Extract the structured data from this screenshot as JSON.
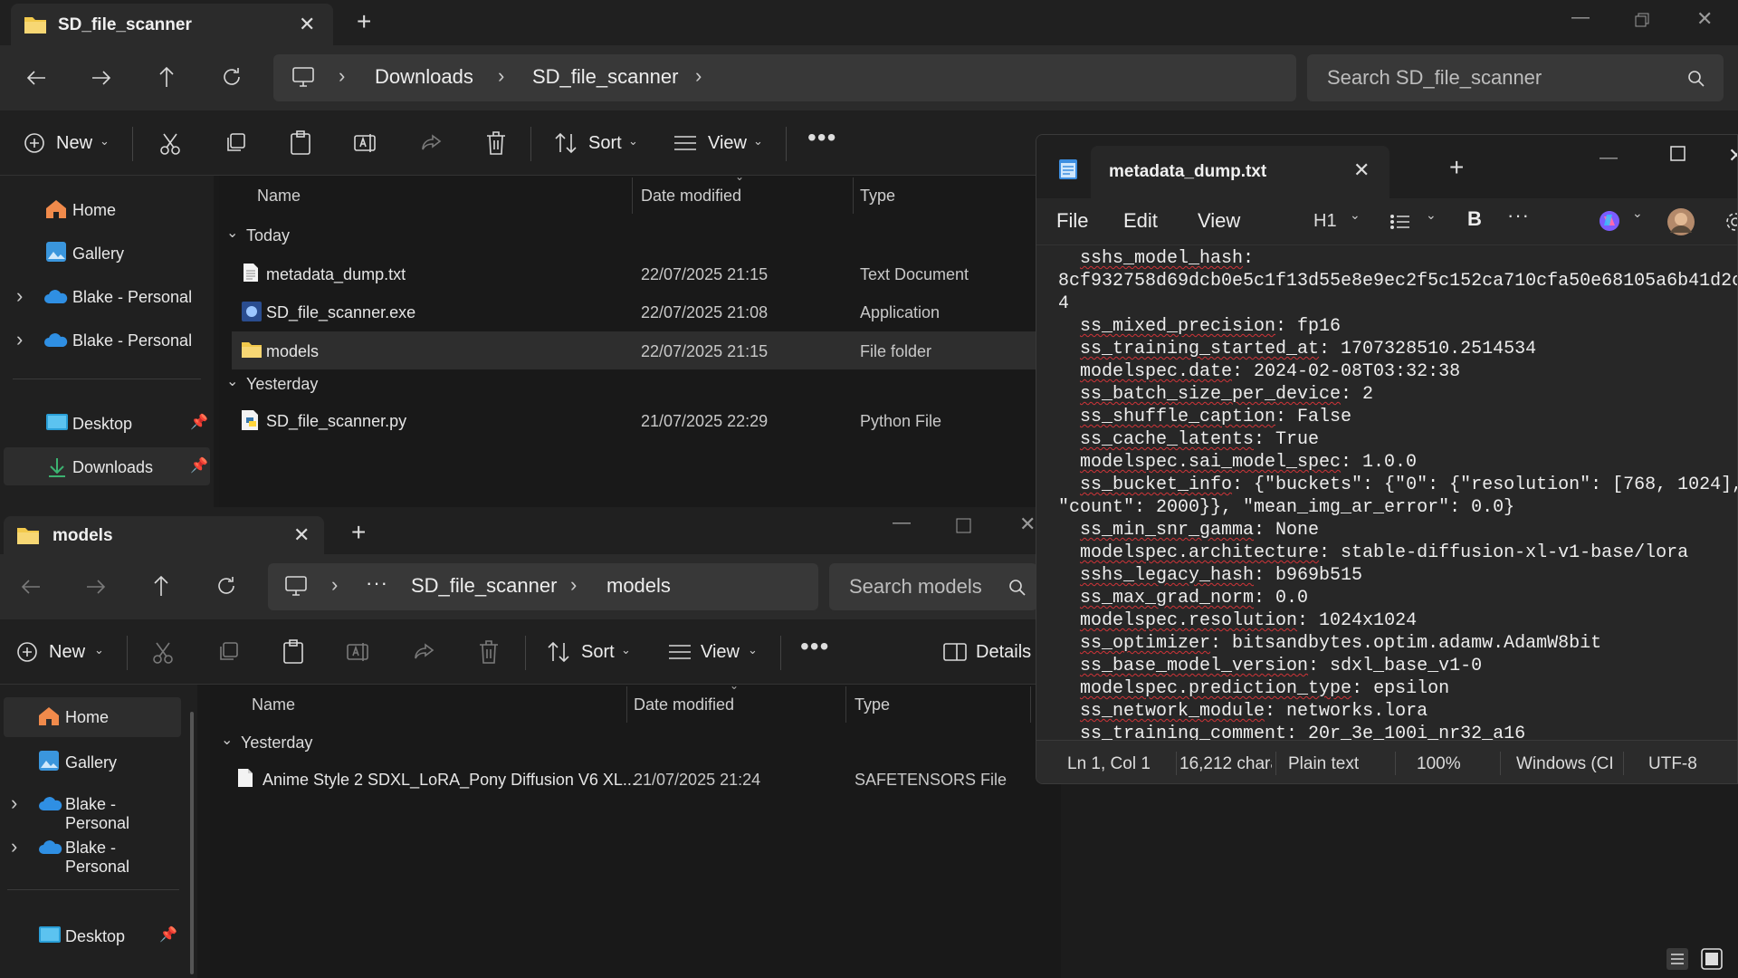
{
  "explorer_top": {
    "tab_title": "SD_file_scanner",
    "breadcrumb": [
      "Downloads",
      "SD_file_scanner"
    ],
    "search_placeholder": "Search SD_file_scanner",
    "commands": {
      "new": "New",
      "sort": "Sort",
      "view": "View"
    },
    "columns": {
      "name": "Name",
      "date": "Date modified",
      "type": "Type"
    },
    "sidebar": [
      {
        "label": "Home",
        "icon": "home-icon"
      },
      {
        "label": "Gallery",
        "icon": "gallery-icon"
      },
      {
        "label": "Blake - Personal",
        "icon": "onedrive-icon"
      },
      {
        "label": "Blake - Personal",
        "icon": "onedrive-icon"
      },
      {
        "label": "Desktop",
        "icon": "desktop-icon"
      },
      {
        "label": "Downloads",
        "icon": "download-icon"
      }
    ],
    "groups": {
      "today": "Today",
      "yesterday": "Yesterday"
    },
    "files": [
      {
        "name": "metadata_dump.txt",
        "date": "22/07/2025 21:15",
        "type": "Text Document",
        "icon": "text-file-icon"
      },
      {
        "name": "SD_file_scanner.exe",
        "date": "22/07/2025 21:08",
        "type": "Application",
        "icon": "app-icon"
      },
      {
        "name": "models",
        "date": "22/07/2025 21:15",
        "type": "File folder",
        "icon": "folder-icon"
      },
      {
        "name": "SD_file_scanner.py",
        "date": "21/07/2025 22:29",
        "type": "Python File",
        "icon": "python-file-icon"
      }
    ]
  },
  "explorer_bottom": {
    "tab_title": "models",
    "breadcrumb": [
      "SD_file_scanner",
      "models"
    ],
    "search_placeholder": "Search models",
    "commands": {
      "new": "New",
      "sort": "Sort",
      "view": "View",
      "details": "Details"
    },
    "columns": {
      "name": "Name",
      "date": "Date modified",
      "type": "Type"
    },
    "sidebar": [
      {
        "label": "Home",
        "icon": "home-icon"
      },
      {
        "label": "Gallery",
        "icon": "gallery-icon"
      },
      {
        "label": "Blake - Personal",
        "icon": "onedrive-icon"
      },
      {
        "label": "Blake - Personal",
        "icon": "onedrive-icon"
      },
      {
        "label": "Desktop",
        "icon": "desktop-icon"
      }
    ],
    "groups": {
      "yesterday": "Yesterday"
    },
    "files": [
      {
        "name": "Anime Style 2 SDXL_LoRA_Pony Diffusion V6 XL...",
        "date": "21/07/2025 21:24",
        "type": "SAFETENSORS File",
        "icon": "file-icon"
      }
    ]
  },
  "notepad": {
    "tab_title": "metadata_dump.txt",
    "menu": {
      "file": "File",
      "edit": "Edit",
      "view": "View",
      "heading": "H1"
    },
    "lines": [
      {
        "key": "sshs_model_hash",
        "val": ":"
      },
      {
        "key": "",
        "val": "8cf932758d69dcb0e5c1f13d55e8e9ec2f5c152ca710cfa50e68105a6b41d2c"
      },
      {
        "key": "",
        "val": "4"
      },
      {
        "key": "ss_mixed_precision",
        "val": ": fp16"
      },
      {
        "key": "ss_training_started_at",
        "val": ": 1707328510.2514534"
      },
      {
        "key": "modelspec.date",
        "val": ": 2024-02-08T03:32:38"
      },
      {
        "key": "ss_batch_size_per_device",
        "val": ": 2"
      },
      {
        "key": "ss_shuffle_caption",
        "val": ": False"
      },
      {
        "key": "ss_cache_latents",
        "val": ": True"
      },
      {
        "key": "modelspec.sai_model_spec",
        "val": ": 1.0.0"
      },
      {
        "key": "ss_bucket_info",
        "val": ": {\"buckets\": {\"0\": {\"resolution\": [768, 1024],"
      },
      {
        "key": "",
        "val": "\"count\": 2000}}, \"mean_img_ar_error\": 0.0}"
      },
      {
        "key": "ss_min_snr_gamma",
        "val": ": None"
      },
      {
        "key": "modelspec.architecture",
        "val": ": stable-diffusion-xl-v1-base/lora"
      },
      {
        "key": "sshs_legacy_hash",
        "val": ": b969b515"
      },
      {
        "key": "ss_max_grad_norm",
        "val": ": 0.0"
      },
      {
        "key": "modelspec.resolution",
        "val": ": 1024x1024"
      },
      {
        "key": "ss_optimizer",
        "val": ": bitsandbytes.optim.adamw.AdamW8bit"
      },
      {
        "key": "ss_base_model_version",
        "val": ": sdxl_base_v1-0"
      },
      {
        "key": "modelspec.prediction_type",
        "val": ": epsilon"
      },
      {
        "key": "ss_network_module",
        "val": ": networks.lora"
      },
      {
        "key": "ss_training_comment",
        "val": ": 20r_3e_100i_nr32_a16"
      }
    ],
    "status": {
      "position": "Ln 1, Col 1",
      "chars": "16,212 charac",
      "format": "Plain text",
      "zoom": "100%",
      "eol": "Windows (CI",
      "encoding": "UTF-8"
    }
  }
}
